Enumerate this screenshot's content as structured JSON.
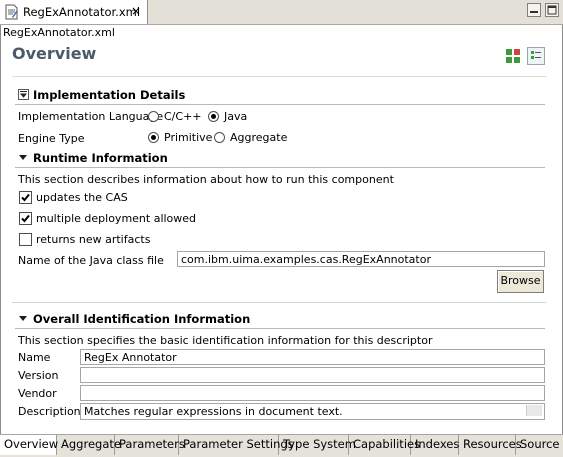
{
  "editor_tab": {
    "title": "RegExAnnotator.xml",
    "close_glyph": "×"
  },
  "window_controls": {
    "minimize": "minimize-icon",
    "maximize": "maximize-icon"
  },
  "breadcrumb": "RegExAnnotator.xml",
  "page": {
    "title": "Overview",
    "layout_icons": [
      "horizontal-layout-icon",
      "vertical-layout-icon"
    ]
  },
  "implementation": {
    "header": "Implementation Details",
    "language_label": "Implementation Language",
    "language_options": [
      {
        "label": "C/C++",
        "selected": false
      },
      {
        "label": "Java",
        "selected": true
      }
    ],
    "engine_label": "Engine Type",
    "engine_options": [
      {
        "label": "Primitive",
        "selected": true
      },
      {
        "label": "Aggregate",
        "selected": false
      }
    ]
  },
  "runtime": {
    "header": "Runtime Information",
    "description": "This section describes information about how to run this component",
    "checkboxes": [
      {
        "label": "updates the CAS",
        "checked": true
      },
      {
        "label": "multiple deployment allowed",
        "checked": true
      },
      {
        "label": "returns new artifacts",
        "checked": false
      }
    ],
    "class_label": "Name of the Java class file",
    "class_value": "com.ibm.uima.examples.cas.RegExAnnotator",
    "browse_label": "Browse"
  },
  "identification": {
    "header": "Overall Identification Information",
    "description": "This section specifies the basic identification information for this descriptor",
    "fields": [
      {
        "label": "Name",
        "value": "RegEx Annotator"
      },
      {
        "label": "Version",
        "value": ""
      },
      {
        "label": "Vendor",
        "value": ""
      },
      {
        "label": "Description:",
        "value": "Matches regular expressions in document text."
      }
    ]
  },
  "bottom_tabs": [
    {
      "label": "Overview",
      "active": true
    },
    {
      "label": "Aggregate",
      "active": false
    },
    {
      "label": "Parameters",
      "active": false
    },
    {
      "label": "Parameter Settings",
      "active": false
    },
    {
      "label": "Type System",
      "active": false
    },
    {
      "label": "Capabilities",
      "active": false
    },
    {
      "label": "Indexes",
      "active": false
    },
    {
      "label": "Resources",
      "active": false
    },
    {
      "label": "Source",
      "active": false
    }
  ],
  "colors": {
    "title": "#4a5a6a",
    "tabstrip": "#e3e0d8",
    "bottom_tabs": "#e5e2da"
  }
}
